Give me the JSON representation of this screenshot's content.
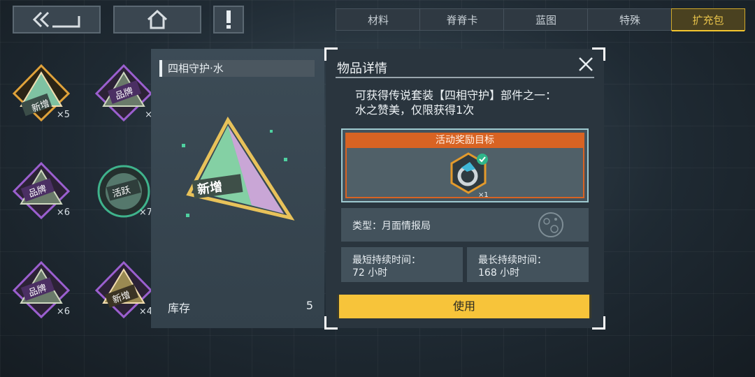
{
  "topbar": {
    "tabs": [
      {
        "label": "材料",
        "active": false
      },
      {
        "label": "脊脊卡",
        "active": false
      },
      {
        "label": "蓝图",
        "active": false
      },
      {
        "label": "特殊",
        "active": false
      },
      {
        "label": "扩充包",
        "active": true
      }
    ]
  },
  "inventory": [
    {
      "badge": "新增",
      "count": "×5"
    },
    {
      "badge": "品牌",
      "count": "×"
    },
    {
      "badge": "品牌",
      "count": "×6"
    },
    {
      "badge": "活跃",
      "count": "×7"
    },
    {
      "badge": "品牌",
      "count": "×6"
    },
    {
      "badge": "新增",
      "count": "×4"
    }
  ],
  "item": {
    "name": "四相守护·水",
    "art_text": "新增",
    "stock_label": "库存",
    "stock_value": "5"
  },
  "detail": {
    "title": "物品详情",
    "description": "可获得传说套装【四相守护】部件之一：水之赞美，仅限获得1次",
    "reward": {
      "header": "活动奖励目标",
      "count": "×1"
    },
    "type_label": "类型：月面情报局",
    "min_duration_label": "最短持续时间：",
    "min_duration_value": "72 小时",
    "max_duration_label": "最长持续时间：",
    "max_duration_value": "168 小时",
    "use_button": "使用"
  },
  "colors": {
    "accent_yellow": "#f7c43a",
    "reward_orange": "#d86323",
    "active_tab": "#e7c24a"
  }
}
